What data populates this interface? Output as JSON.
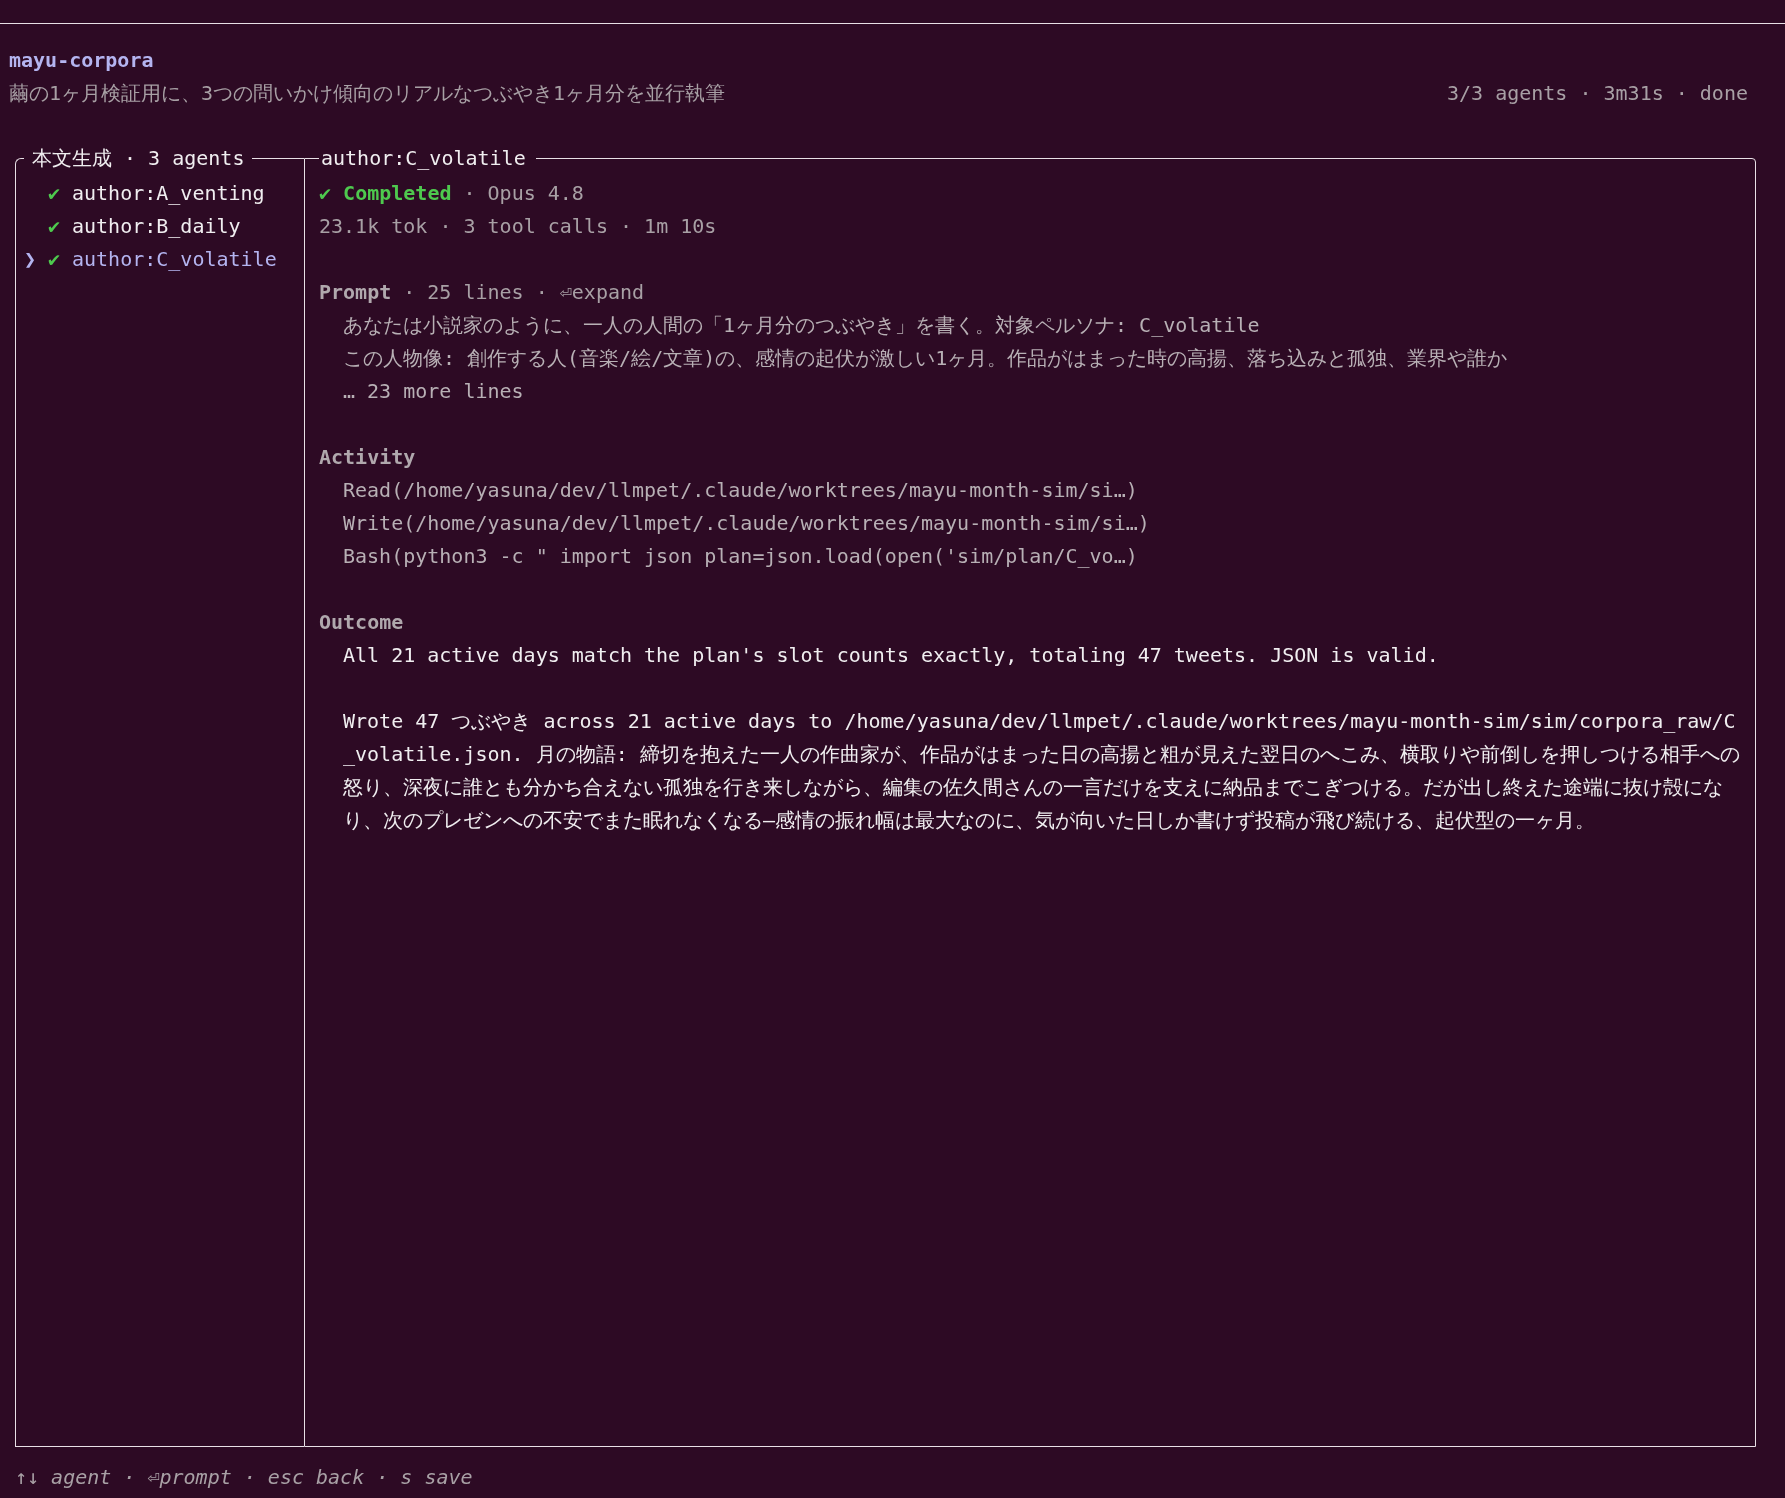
{
  "header": {
    "title": "mayu-corpora",
    "subtitle": "繭の1ヶ月検証用に、3つの問いかけ傾向のリアルなつぶやき1ヶ月分を並行執筆",
    "status": "3/3 agents · 3m31s · done"
  },
  "agent_list": {
    "title": "本文生成 · 3 agents",
    "cursor": "❯",
    "agents": [
      {
        "mark": "✔",
        "name": "author:A_venting",
        "done": true,
        "selected": false
      },
      {
        "mark": "✔",
        "name": "author:B_daily",
        "done": true,
        "selected": false
      },
      {
        "mark": "✔",
        "name": "author:C_volatile",
        "done": true,
        "selected": true
      }
    ]
  },
  "detail": {
    "title": "author:C_volatile",
    "status_mark": "✔",
    "status_label": "Completed",
    "status_detail": "· Opus 4.8",
    "stats": "23.1k tok · 3 tool calls · 1m 10s",
    "prompt": {
      "heading": "Prompt",
      "meta": "· 25 lines · ⏎expand",
      "lines": [
        "あなたは小説家のように、一人の人間の「1ヶ月分のつぶやき」を書く。対象ペルソナ: C_volatile",
        "この人物像: 創作する人(音楽/絵/文章)の、感情の起伏が激しい1ヶ月。作品がはまった時の高揚、落ち込みと孤独、業界や誰か",
        "… 23 more lines"
      ]
    },
    "activity": {
      "heading": "Activity",
      "lines": [
        "Read(/home/yasuna/dev/llmpet/.claude/worktrees/mayu-month-sim/si…)",
        "Write(/home/yasuna/dev/llmpet/.claude/worktrees/mayu-month-sim/si…)",
        "Bash(python3 -c \" import json plan=json.load(open('sim/plan/C_vo…)"
      ]
    },
    "outcome": {
      "heading": "Outcome",
      "paragraphs": [
        "All 21 active days match the plan's slot counts exactly, totaling 47 tweets. JSON is valid.",
        "Wrote 47 つぶやき across 21 active days to /home/yasuna/dev/llmpet/.claude/worktrees/mayu-month-sim/sim/corpora_raw/C_volatile.json. 月の物語: 締切を抱えた一人の作曲家が、作品がはまった日の高揚と粗が見えた翌日のへこみ、横取りや前倒しを押しつける相手への怒り、深夜に誰とも分かち合えない孤独を行き来しながら、編集の佐久間さんの一言だけを支えに納品までこぎつける。だが出し終えた途端に抜け殻になり、次のプレゼンへの不安でまた眠れなくなる—感情の振れ幅は最大なのに、気が向いた日しか書けず投稿が飛び続ける、起伏型の一ヶ月。"
      ]
    }
  },
  "footer": "↑↓ agent · ⏎prompt · esc back · s save"
}
